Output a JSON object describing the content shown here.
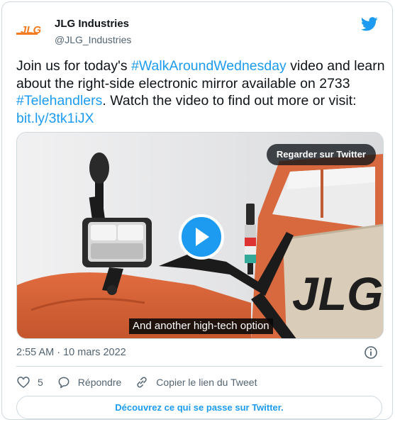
{
  "author": {
    "logo_text": "JLG",
    "display_name": "JLG Industries",
    "handle": "@JLG_Industries"
  },
  "icons": {
    "brand": "twitter-bird-icon",
    "play": "play-icon",
    "info": "info-icon",
    "like": "heart-icon",
    "reply": "reply-bubble-icon",
    "link": "link-icon"
  },
  "tweet": {
    "t1": "Join us for today's ",
    "hashtag1": "#WalkAroundWednesday",
    "t2": " video and learn about the right-side electronic mirror available on 2733 ",
    "hashtag2": "#Telehandlers",
    "t3": ". Watch the video to find out more or visit: ",
    "link": "bit.ly/3tk1iJX"
  },
  "media": {
    "watch_label": "Regarder sur Twitter",
    "caption": "And another high-tech option",
    "decal_text": "JLG"
  },
  "meta": {
    "timestamp": "2:55 AM · 10 mars 2022"
  },
  "actions": {
    "like_count": "5",
    "reply_label": "Répondre",
    "copy_link_label": "Copier le lien du Tweet"
  },
  "footer": {
    "discover_label": "Découvrez ce qui se passe sur Twitter."
  },
  "colors": {
    "brand_blue": "#1d9bf0",
    "logo_orange": "#f47b20",
    "machine_orange": "#d5653c"
  }
}
